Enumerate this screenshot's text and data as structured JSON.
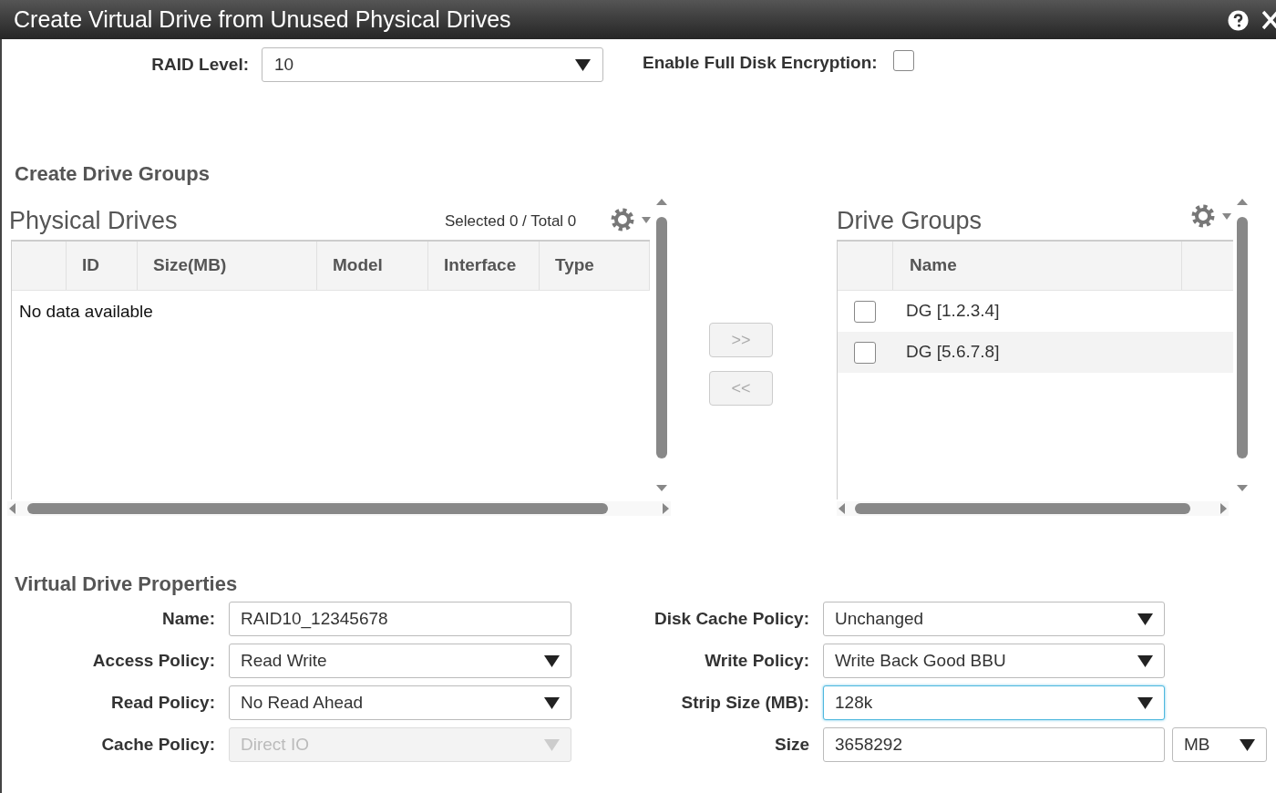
{
  "dialog": {
    "title": "Create Virtual Drive from Unused Physical Drives"
  },
  "raid_level": {
    "label": "RAID Level:",
    "value": "10"
  },
  "encryption": {
    "label": "Enable Full Disk Encryption:",
    "checked": false
  },
  "drive_groups_section": {
    "heading": "Create Drive Groups"
  },
  "physical_drives": {
    "title": "Physical Drives",
    "summary": "Selected 0 / Total 0",
    "columns": [
      "ID",
      "Size(MB)",
      "Model",
      "Interface",
      "Type"
    ],
    "empty_text": "No data available"
  },
  "move_buttons": [
    {
      "label": ">>",
      "disabled": true
    },
    {
      "label": "<<",
      "disabled": true
    }
  ],
  "drive_groups": {
    "title": "Drive Groups",
    "columns": [
      "Name"
    ],
    "rows": [
      {
        "name": "DG [1.2.3.4]",
        "checked": false
      },
      {
        "name": "DG [5.6.7.8]",
        "checked": false
      }
    ]
  },
  "properties": {
    "heading": "Virtual Drive Properties",
    "left_fields": [
      {
        "kind": "text",
        "label": "Name:",
        "value": "RAID10_12345678",
        "disabled": false,
        "focused": false
      },
      {
        "kind": "select",
        "label": "Access Policy:",
        "value": "Read Write",
        "disabled": false,
        "focused": false
      },
      {
        "kind": "select",
        "label": "Read Policy:",
        "value": "No Read Ahead",
        "disabled": false,
        "focused": false
      },
      {
        "kind": "select",
        "label": "Cache Policy:",
        "value": "Direct IO",
        "disabled": true,
        "focused": false
      }
    ],
    "right_fields": [
      {
        "kind": "select",
        "label": "Disk Cache Policy:",
        "value": "Unchanged",
        "disabled": false,
        "focused": false
      },
      {
        "kind": "select",
        "label": "Write Policy:",
        "value": "Write Back Good BBU",
        "disabled": false,
        "focused": false
      },
      {
        "kind": "select",
        "label": "Strip Size (MB):",
        "value": "128k",
        "disabled": false,
        "focused": true
      },
      {
        "kind": "text",
        "label": "Size",
        "value": "3658292",
        "disabled": false,
        "focused": false,
        "unit": "MB"
      }
    ]
  }
}
